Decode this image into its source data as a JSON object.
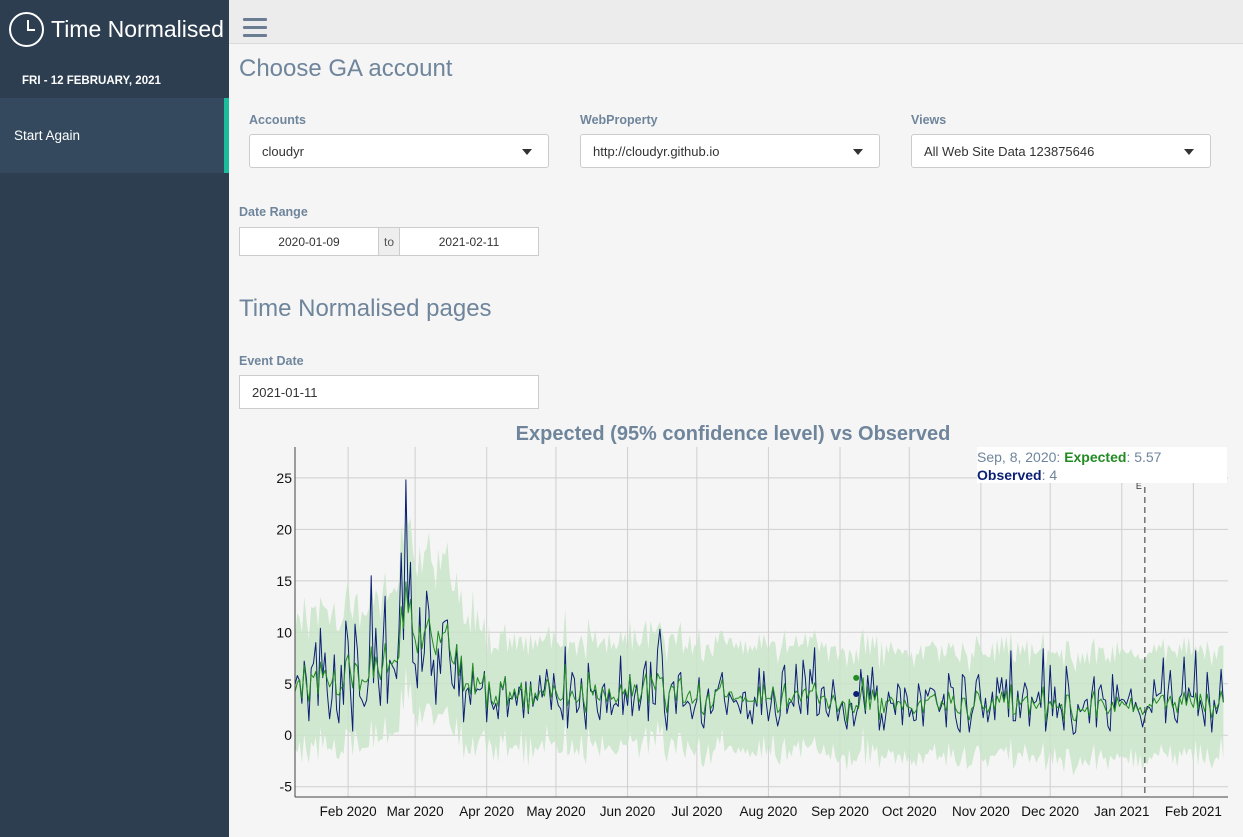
{
  "app": {
    "title": "Time Normalised",
    "date_label": "FRI - 12 FEBRUARY, 2021"
  },
  "sidebar": {
    "items": [
      {
        "label": "Start Again"
      }
    ]
  },
  "section1": {
    "title": "Choose GA account",
    "accounts": {
      "label": "Accounts",
      "value": "cloudyr"
    },
    "webproperty": {
      "label": "WebProperty",
      "value": "http://cloudyr.github.io"
    },
    "views": {
      "label": "Views",
      "value": "All Web Site Data 123875646"
    },
    "daterange": {
      "label": "Date Range",
      "start": "2020-01-09",
      "sep": "to",
      "end": "2021-02-11"
    }
  },
  "section2": {
    "title": "Time Normalised pages",
    "eventdate": {
      "label": "Event Date",
      "value": "2021-01-11"
    }
  },
  "tooltip": {
    "date": "Sep, 8, 2020:",
    "expected_label": "Expected",
    "expected_value": ": 5.57",
    "observed_label": "Observed",
    "observed_value": ": 4"
  },
  "colors": {
    "sidebar": "#2c3e50",
    "accent": "#1abc9c",
    "expected": "#228b22",
    "observed": "#0b1f74",
    "band": "#c9e4c9"
  },
  "chart_data": {
    "type": "line",
    "title": "Expected (95% confidence level) vs Observed",
    "x_start": "2020-01-09",
    "x_end": "2021-02-11",
    "xlim": [
      "2020-01-09",
      "2021-02-16"
    ],
    "ylim": [
      -6,
      28
    ],
    "y_ticks": [
      -5,
      0,
      5,
      10,
      15,
      20,
      25
    ],
    "x_ticks": [
      "Feb 2020",
      "Mar 2020",
      "Apr 2020",
      "May 2020",
      "Jun 2020",
      "Jul 2020",
      "Aug 2020",
      "Sep 2020",
      "Oct 2020",
      "Nov 2020",
      "Dec 2020",
      "Jan 2021",
      "Feb 2021"
    ],
    "x_tick_dates": [
      "2020-02-01",
      "2020-03-01",
      "2020-04-01",
      "2020-05-01",
      "2020-06-01",
      "2020-07-01",
      "2020-08-01",
      "2020-09-01",
      "2020-10-01",
      "2020-11-01",
      "2020-12-01",
      "2021-01-01",
      "2021-02-01"
    ],
    "event_date": "2021-01-11",
    "event_marker": "E",
    "highlight": {
      "date": "2020-09-08",
      "expected": 5.57,
      "observed": 4
    },
    "grid": true,
    "series": [
      {
        "name": "Expected",
        "values": [
          4.2,
          5.1,
          5.4,
          3.6,
          6.8,
          4.8,
          3.3,
          5.9,
          5.6,
          6.2,
          4.0,
          7.1,
          5.7,
          6.3,
          5.4,
          4.7,
          5.2,
          6.3,
          4.0,
          3.9,
          4.6,
          4.8,
          7.2,
          7.8,
          6.2,
          4.6,
          7.0,
          6.7,
          4.3,
          5.4,
          5.2,
          5.2,
          5.6,
          8.6,
          5.6,
          7.6,
          6.4,
          5.4,
          6.8,
          8.9,
          6.1,
          7.0,
          6.9,
          7.3,
          7.1,
          7.6,
          12.5,
          10.4,
          14.9,
          11.9,
          13.2,
          10.0,
          9.3,
          8.0,
          10.6,
          8.4,
          10.0,
          10.6,
          11.4,
          9.8,
          8.6,
          7.8,
          10.1,
          9.0,
          9.9,
          10.0,
          10.8,
          8.3,
          7.2,
          6.9,
          8.8,
          5.8,
          7.7,
          4.3,
          5.0,
          5.0,
          4.0,
          7.0,
          4.0,
          5.6,
          5.0,
          5.1,
          6.0,
          2.6,
          5.2,
          3.4,
          3.0,
          3.8,
          2.8,
          5.2,
          4.5,
          5.7,
          2.9,
          4.2,
          3.5,
          4.5,
          3.6,
          4.0,
          5.1,
          2.7,
          4.8,
          2.3,
          4.9,
          3.0,
          4.1,
          3.5,
          4.3,
          4.3,
          3.8,
          5.4,
          5.1,
          3.7,
          4.8,
          4.3,
          3.6,
          3.4,
          3.6,
          6.9,
          2.9,
          3.7,
          4.3,
          3.6,
          3.2,
          3.5,
          5.0,
          3.3,
          2.2,
          6.1,
          4.6,
          3.9,
          4.9,
          3.6,
          3.4,
          4.6,
          4.0,
          3.3,
          4.5,
          3.5,
          3.7,
          3.2,
          3.6,
          4.9,
          4.0,
          4.5,
          3.6,
          5.8,
          3.8,
          4.9,
          4.4,
          3.2,
          4.0,
          5.1,
          6.0,
          3.2,
          5.8,
          5.1,
          4.4,
          6.0,
          5.5,
          5.6,
          3.7,
          2.2,
          4.1,
          4.8,
          4.6,
          3.4,
          5.2,
          5.6,
          3.2,
          3.2,
          3.9,
          4.3,
          3.1,
          3.4,
          3.6,
          5.1,
          2.3,
          2.0,
          3.4,
          4.0,
          2.6,
          3.0,
          4.2,
          4.4,
          4.6,
          5.4,
          3.8,
          3.7,
          4.2,
          4.2,
          3.4,
          3.6,
          3.6,
          3.8,
          3.3,
          3.7,
          3.3,
          3.3,
          3.3,
          3.4,
          3.1,
          4.7,
          3.1,
          4.9,
          3.5,
          3.6,
          3.5,
          4.7,
          3.5,
          2.2,
          2.5,
          3.9,
          5.0,
          2.7,
          3.6,
          3.3,
          3.9,
          4.3,
          4.0,
          3.3,
          4.3,
          4.5,
          3.6,
          4.3,
          4.3,
          5.1,
          3.9,
          3.1,
          3.7,
          3.8,
          3.5,
          2.6,
          3.1,
          3.9,
          3.3,
          2.3,
          2.8,
          3.3,
          3.1,
          1.2,
          3.5,
          2.5,
          2.2,
          2.9,
          2.6,
          4.0,
          5.57,
          2.4,
          4.7,
          2.5,
          4.4,
          3.4,
          4.3,
          1.5,
          3.6,
          2.2,
          3.3,
          3.3,
          3.7,
          3.4,
          2.5,
          3.3,
          3.2,
          2.5,
          3.4,
          2.8,
          2.7,
          2.6,
          2.1,
          2.4,
          3.1,
          3.4,
          2.2,
          3.4,
          3.4,
          3.7,
          3.8,
          4.0,
          3.0,
          2.5,
          3.3,
          3.0,
          2.4,
          4.2,
          3.1,
          3.8,
          2.6,
          2.2,
          2.1,
          3.6,
          3.6,
          2.2,
          1.5,
          2.6,
          2.8,
          4.3,
          4.0,
          3.1,
          2.6,
          2.8,
          2.2,
          2.8,
          3.5,
          2.5,
          3.8,
          3.2,
          4.2,
          3.2,
          4.3,
          2.6,
          4.9,
          2.0,
          2.1,
          3.7,
          3.0,
          3.3,
          3.6,
          3.8,
          2.0,
          3.5,
          3.0,
          2.6,
          3.0,
          3.3,
          4.7,
          1.4,
          2.9,
          3.3,
          2.6,
          3.4,
          2.7,
          2.7,
          3.0,
          1.4,
          3.9,
          3.9,
          2.5,
          1.5,
          1.4,
          2.6,
          2.4,
          2.5,
          2.3,
          2.7,
          1.9,
          3.5,
          4.3,
          1.7,
          3.3,
          3.5,
          3.1,
          2.5,
          2.1,
          2.5,
          3.2,
          2.3,
          3.7,
          2.8,
          3.3,
          3.0,
          2.9,
          2.6,
          3.6,
          2.3,
          3.0,
          2.4,
          2.7,
          2.0,
          2.4,
          2.5,
          3.0,
          2.8,
          3.6,
          3.1,
          3.4,
          3.8,
          3.9,
          2.6,
          3.3,
          3.8,
          2.7,
          3.2,
          2.2,
          3.7,
          3.0,
          4.2,
          2.9,
          4.1,
          3.2,
          2.7,
          4.1,
          2.5,
          4.0,
          3.0,
          2.3,
          4.0,
          2.8,
          1.7,
          2.9,
          2.6,
          3.1,
          4.3,
          3.2
        ]
      },
      {
        "name": "Observed",
        "values": [
          4.9,
          5.8,
          5.3,
          3.1,
          7.2,
          5.4,
          1.4,
          6.5,
          7.0,
          9.0,
          2.9,
          10.4,
          5.6,
          8.0,
          4.1,
          1.6,
          3.6,
          7.8,
          2.5,
          1.2,
          6.8,
          3.0,
          11.1,
          9.1,
          4.3,
          0.4,
          10.8,
          8.3,
          3.8,
          3.4,
          2.8,
          3.4,
          5.8,
          15.5,
          5.1,
          10.4,
          5.6,
          2.9,
          8.6,
          13.5,
          3.1,
          7.3,
          6.8,
          6.4,
          5.5,
          10.0,
          17.7,
          9.3,
          24.8,
          12.4,
          16.8,
          7.1,
          6.9,
          4.6,
          12.4,
          6.2,
          8.0,
          14.0,
          12.1,
          5.8,
          7.3,
          3.0,
          8.4,
          6.0,
          10.9,
          11.1,
          11.2,
          7.6,
          5.0,
          4.5,
          8.8,
          3.8,
          7.5,
          1.3,
          4.3,
          4.6,
          3.0,
          6.2,
          4.1,
          4.5,
          4.4,
          4.6,
          6.2,
          1.3,
          5.0,
          3.2,
          2.5,
          3.1,
          1.6,
          5.1,
          4.4,
          5.7,
          1.8,
          3.6,
          3.5,
          4.2,
          2.9,
          4.7,
          4.4,
          1.7,
          5.2,
          2.1,
          5.2,
          2.8,
          3.8,
          3.4,
          5.8,
          3.7,
          4.5,
          6.4,
          4.8,
          2.5,
          6.0,
          3.9,
          2.9,
          2.6,
          1.5,
          8.6,
          0.7,
          4.0,
          6.1,
          5.5,
          2.2,
          2.7,
          5.5,
          2.8,
          0.6,
          7.0,
          4.3,
          4.2,
          4.4,
          2.3,
          1.5,
          4.6,
          5.0,
          2.2,
          4.4,
          2.0,
          2.9,
          3.1,
          2.8,
          7.7,
          2.0,
          4.4,
          2.9,
          5.9,
          1.9,
          3.8,
          4.9,
          2.4,
          3.7,
          6.3,
          7.2,
          1.4,
          7.1,
          3.1,
          3.0,
          8.3,
          10.3,
          7.7,
          2.3,
          0.5,
          4.1,
          4.9,
          5.2,
          2.1,
          5.8,
          6.1,
          2.8,
          3.0,
          3.3,
          3.0,
          1.6,
          2.6,
          3.4,
          5.6,
          1.2,
          0.7,
          3.3,
          4.5,
          2.1,
          2.5,
          4.4,
          4.4,
          5.3,
          6.1,
          3.4,
          2.0,
          4.1,
          3.6,
          3.2,
          3.4,
          2.9,
          2.1,
          4.1,
          4.2,
          1.6,
          2.4,
          1.1,
          3.7,
          2.8,
          6.5,
          2.0,
          6.2,
          3.3,
          1.4,
          2.8,
          4.7,
          2.1,
          0.9,
          1.9,
          6.1,
          6.8,
          2.1,
          3.1,
          3.3,
          2.8,
          6.9,
          3.2,
          2.1,
          7.3,
          5.5,
          2.0,
          6.4,
          5.0,
          8.5,
          1.9,
          2.1,
          4.5,
          4.7,
          2.3,
          1.8,
          3.1,
          5.4,
          3.6,
          1.4,
          2.6,
          3.2,
          1.5,
          0.6,
          3.0,
          3.1,
          0.9,
          2.0,
          3.0,
          6.4,
          4.0,
          2.1,
          5.8,
          3.5,
          6.6,
          3.5,
          4.8,
          0.5,
          2.1,
          0.5,
          2.3,
          4.2,
          3.1,
          3.1,
          2.0,
          5.0,
          4.5,
          1.0,
          4.6,
          3.8,
          1.8,
          2.6,
          1.4,
          1.5,
          5.0,
          3.8,
          0.9,
          4.4,
          3.8,
          4.6,
          4.5,
          4.3,
          3.1,
          2.3,
          2.9,
          4.0,
          0.8,
          6.0,
          4.7,
          4.6,
          1.8,
          0.7,
          0.3,
          5.9,
          5.6,
          2.5,
          0.3,
          2.0,
          2.9,
          5.3,
          5.9,
          3.4,
          1.7,
          3.6,
          1.3,
          2.5,
          4.2,
          1.5,
          5.6,
          4.1,
          5.6,
          3.4,
          5.4,
          1.8,
          8.2,
          1.4,
          1.4,
          4.3,
          1.7,
          3.8,
          5.1,
          4.4,
          0.9,
          3.7,
          3.1,
          3.3,
          4.2,
          2.7,
          8.4,
          0.4,
          2.3,
          6.8,
          1.9,
          4.7,
          1.7,
          3.1,
          2.3,
          0.5,
          6.7,
          4.7,
          1.8,
          0.1,
          0.3,
          3.0,
          2.3,
          2.5,
          3.3,
          3.5,
          1.2,
          4.0,
          5.7,
          0.8,
          4.4,
          4.9,
          3.5,
          3.4,
          0.9,
          0.4,
          5.9,
          2.5,
          4.9,
          3.3,
          3.5,
          3.4,
          3.0,
          3.7,
          4.5,
          2.3,
          3.2,
          2.5,
          1.9,
          0.8,
          1.8,
          2.8,
          2.7,
          2.2,
          5.4,
          3.8,
          4.0,
          4.1,
          7.5,
          1.2,
          4.2,
          6.3,
          3.1,
          1.6,
          1.2,
          3.6,
          4.0,
          7.6,
          3.0,
          4.6,
          3.8,
          3.7,
          8.2,
          1.9,
          3.4,
          2.3,
          0.9,
          6.1,
          3.4,
          0.3,
          3.4,
          2.1,
          3.0,
          6.4,
          3.2
        ]
      }
    ]
  }
}
